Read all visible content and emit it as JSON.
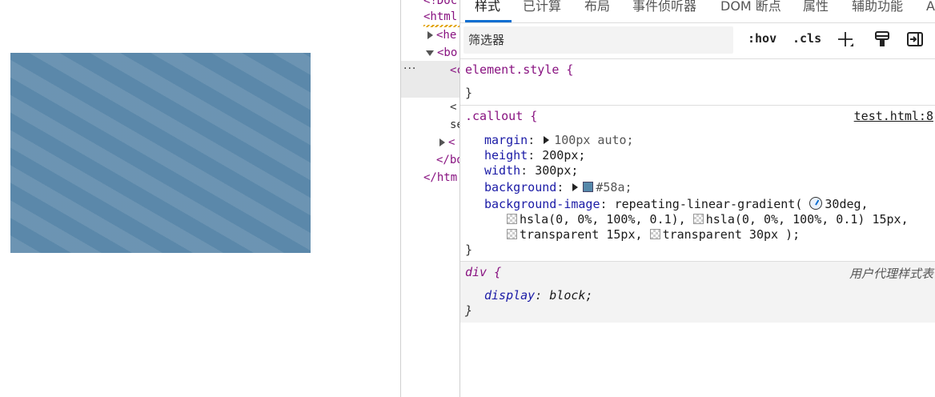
{
  "elements": {
    "lines": [
      {
        "text": "<!Doc",
        "kind": "tag"
      },
      {
        "text": "<html",
        "kind": "tag"
      },
      {
        "text": "<he",
        "kind": "tag"
      },
      {
        "text": "<bo",
        "kind": "tag"
      },
      {
        "text": "<c",
        "kind": "tag"
      },
      {
        "text": "<",
        "kind": "plain"
      },
      {
        "text": "se",
        "kind": "plain"
      },
      {
        "text": "<",
        "kind": "tag"
      },
      {
        "text": "</bo",
        "kind": "tag"
      },
      {
        "text": "</htm",
        "kind": "tag"
      }
    ],
    "dots": "···"
  },
  "tabs": [
    "样式",
    "已计算",
    "布局",
    "事件侦听器",
    "DOM 断点",
    "属性",
    "辅助功能",
    "A"
  ],
  "toolbar": {
    "filter_placeholder": "筛选器",
    "hov": ":hov",
    "cls": ".cls"
  },
  "rules": {
    "element_style": {
      "selector": "element.style {",
      "close": "}"
    },
    "callout": {
      "selector": ".callout {",
      "source": "test.html:8",
      "margin_prop": "margin",
      "margin_val": "100px auto;",
      "height_prop": "height",
      "height_val": "200px;",
      "width_prop": "width",
      "width_val": "300px;",
      "bg_prop": "background",
      "bg_val": "#58a;",
      "bgimg_prop": "background-image",
      "bgimg_fn": "repeating-linear-gradient(",
      "bgimg_angle": "30deg,",
      "bgimg_l2a": "hsla(0, 0%, 100%, 0.1),",
      "bgimg_l2b": "hsla(0, 0%, 100%, 0.1) 15px,",
      "bgimg_l3a": "transparent 15px,",
      "bgimg_l3b": "transparent 30px );",
      "close": "}"
    },
    "div": {
      "selector": "div {",
      "source": "用户代理样式表",
      "display_prop": "display",
      "display_val": "block;",
      "close": "}"
    }
  },
  "colors": {
    "callout_bg": "#5588aa",
    "accent": "#0a6ed1"
  },
  "icons": {
    "add_rule": "plus-icon",
    "paint": "paint-brush-icon",
    "toggle_sidebar": "sidebar-toggle-icon",
    "angle": "angle-icon"
  }
}
